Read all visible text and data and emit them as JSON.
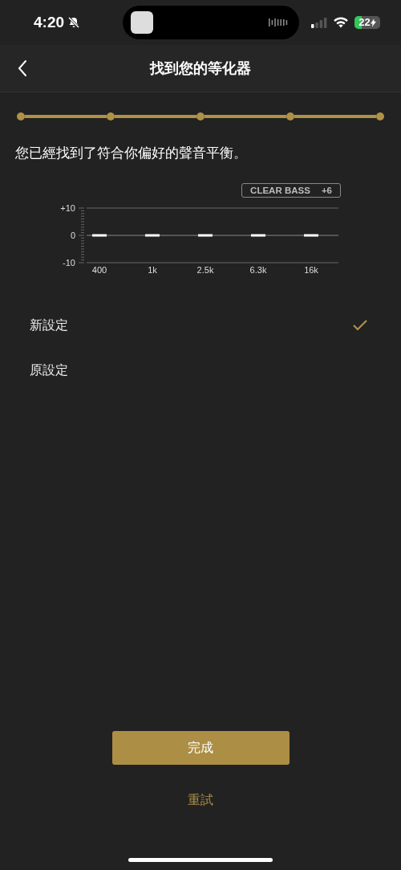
{
  "status_bar": {
    "time": "4:20",
    "battery": "22"
  },
  "nav": {
    "title": "找到您的等化器"
  },
  "steps": [
    {
      "done": true
    },
    {
      "done": true
    },
    {
      "done": true
    },
    {
      "done": true
    },
    {
      "done": true
    }
  ],
  "message": "您已經找到了符合你偏好的聲音平衡。",
  "eq": {
    "badge": {
      "label": "CLEAR BASS",
      "value": "+6"
    },
    "chart_data": {
      "type": "bar",
      "categories": [
        "400",
        "1k",
        "2.5k",
        "6.3k",
        "16k"
      ],
      "values": [
        0,
        0,
        0,
        0,
        0
      ],
      "ylim": [
        -10,
        10
      ],
      "yticks": [
        {
          "value": 10,
          "label": "+10"
        },
        0,
        -10
      ]
    }
  },
  "options": [
    {
      "label": "新設定",
      "selected": true
    },
    {
      "label": "原設定",
      "selected": false
    }
  ],
  "done_button": "完成",
  "retry_link": "重試"
}
